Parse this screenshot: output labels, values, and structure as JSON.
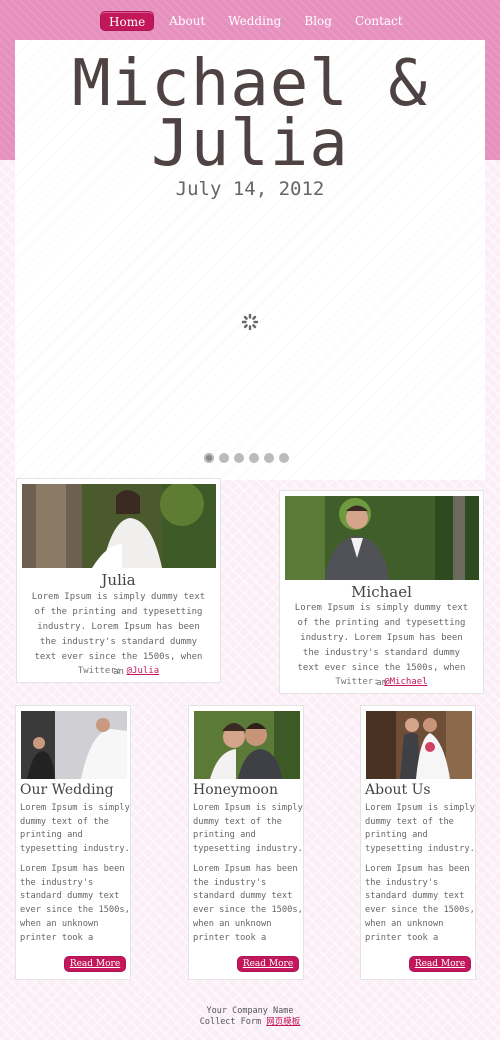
{
  "nav": {
    "items": [
      {
        "label": "Home"
      },
      {
        "label": "About"
      },
      {
        "label": "Wedding"
      },
      {
        "label": "Blog"
      },
      {
        "label": "Contact"
      }
    ]
  },
  "hero": {
    "title_line1": "Michael &",
    "title_line2": "Julia",
    "date": "July 14, 2012",
    "slide_count": 6,
    "active_slide": 1
  },
  "people": [
    {
      "name": "Julia",
      "bio": "Lorem Ipsum is simply dummy text of the printing and typesetting industry. Lorem Ipsum has been the industry's standard dummy text ever since the 1500s, when an",
      "twitter_label": "Twitter: ",
      "twitter_handle": "@Julia"
    },
    {
      "name": "Michael",
      "bio": "Lorem Ipsum is simply dummy text of the printing and typesetting industry. Lorem Ipsum has been the industry's standard dummy text ever since the 1500s, when an",
      "twitter_label": "Twitter: ",
      "twitter_handle": "@Michael"
    }
  ],
  "cards": [
    {
      "title": "Our Wedding",
      "p1": "Lorem Ipsum is simply dummy text of the printing and typesetting industry.",
      "p2": "Lorem Ipsum has been the industry's standard dummy text ever since the 1500s, when an unknown printer took a",
      "button": "Read More"
    },
    {
      "title": "Honeymoon",
      "p1": "Lorem Ipsum is simply dummy text of the printing and typesetting industry.",
      "p2": "Lorem Ipsum has been the industry's standard dummy text ever since the 1500s, when an unknown printer took a",
      "button": "Read More"
    },
    {
      "title": "About Us",
      "p1": "Lorem Ipsum is simply dummy text of the printing and typesetting industry.",
      "p2": "Lorem Ipsum has been the industry's standard dummy text ever since the 1500s, when an unknown printer took a",
      "button": "Read More"
    }
  ],
  "footer": {
    "line1": "Your Company Name",
    "line2_text": "Collect Form ",
    "line2_link": "网页模板"
  },
  "colors": {
    "accent": "#c2185b",
    "band": "#e78fbd"
  }
}
